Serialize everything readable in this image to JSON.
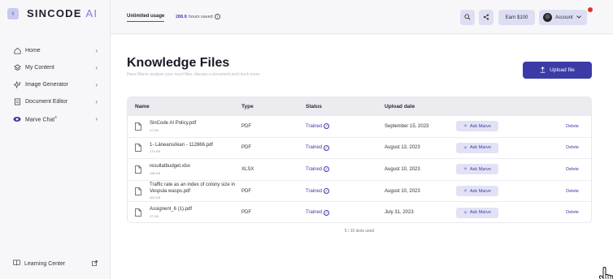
{
  "sidebar": {
    "collapse_icon": "chevron-left-icon",
    "brand_main": "SINCODE",
    "brand_ai": "AI",
    "items": [
      {
        "label": "Home",
        "icon": "home-icon"
      },
      {
        "label": "My Content",
        "icon": "layers-icon"
      },
      {
        "label": "Image Generator",
        "icon": "sparkle-icon"
      },
      {
        "label": "Document Editor",
        "icon": "document-icon"
      },
      {
        "label": "Marve Chat",
        "icon": "marve-eye-icon",
        "superscript": "®"
      }
    ],
    "footer": {
      "label": "Learning Center",
      "icon": "book-icon",
      "action_icon": "external-link-icon"
    }
  },
  "topbar": {
    "usage_label": "Unlimited usage",
    "hours_value": "288.8",
    "hours_label": "hours saved",
    "earn_label": "Earn $100",
    "account_label": "Account"
  },
  "main": {
    "title": "Knowledge Files",
    "subtitle": "Have Marve analyse your excel files, discuss a document and much more.",
    "upload_label": "Upload file",
    "table": {
      "headers": {
        "name": "Name",
        "type": "Type",
        "status": "Status",
        "date": "Upload date"
      },
      "rows": [
        {
          "name": "SinCode AI Policy.pdf",
          "size": "47 KB",
          "type": "PDF",
          "status": "Trained",
          "date": "September 15, 2023",
          "ask": "Ask Marve",
          "delete": "Delete"
        },
        {
          "name": "1- Läneansökan - 112866.pdf",
          "size": "170 KB",
          "type": "PDF",
          "status": "Trained",
          "date": "August 13, 2023",
          "ask": "Ask Marve",
          "delete": "Delete"
        },
        {
          "name": "resultatbudget.xlsx",
          "size": "186 KB",
          "type": "XLSX",
          "status": "Trained",
          "date": "August 10, 2023",
          "ask": "Ask Marve",
          "delete": "Delete"
        },
        {
          "name": "Traffic rate as an index of colony size in Vespula wasps.pdf",
          "size": "469 KB",
          "type": "PDF",
          "status": "Trained",
          "date": "August 10, 2023",
          "ask": "Ask Marve",
          "delete": "Delete"
        },
        {
          "name": "Assignent_6 (1).pdf",
          "size": "37 KB",
          "type": "PDF",
          "status": "Trained",
          "date": "July 31, 2023",
          "ask": "Ask Marve",
          "delete": "Delete"
        }
      ]
    },
    "slots_text": "5 / 10 slots used"
  }
}
